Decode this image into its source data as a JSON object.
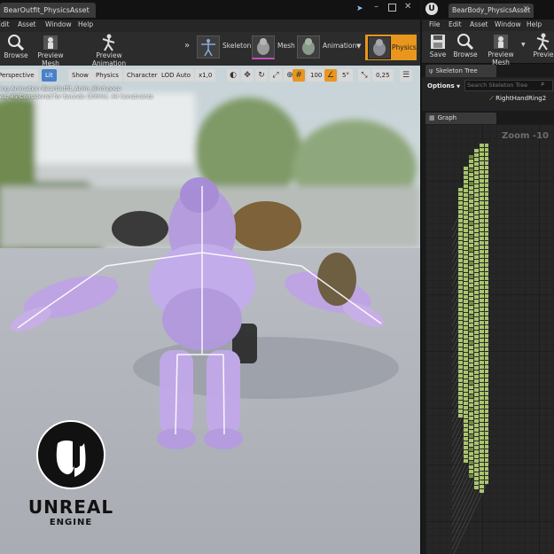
{
  "left_window": {
    "tab_title": "BearOutfit_PhysicsAsset",
    "menu": [
      "Edit",
      "Asset",
      "Window",
      "Help"
    ],
    "toolbar": [
      {
        "label": "Browse",
        "icon": "browse-icon"
      },
      {
        "label": "Preview Mesh",
        "icon": "preview-mesh-icon"
      },
      {
        "label": "Preview Animation",
        "icon": "preview-animation-icon"
      }
    ],
    "modes": [
      {
        "label": "Skeleton",
        "icon": "skeleton-icon"
      },
      {
        "label": "Mesh",
        "icon": "mesh-icon"
      },
      {
        "label": "Animation",
        "icon": "animation-icon"
      },
      {
        "label": "Physics",
        "icon": "physics-icon",
        "active": true
      }
    ],
    "viewport_toolbar": {
      "perspective": "Perspective",
      "lit": "Lit",
      "show": "Show",
      "physics": "Physics",
      "character": "Character",
      "lod": "LOD Auto",
      "speed": "x1,0",
      "grid_size": "100",
      "angle": "5°",
      "scale": "0,25"
    },
    "viewport_info": [
      "ing Animation BearOutfit_Anim_Bind-pose",
      "es, 45 Considered for bounds (100%), 44 Constraints"
    ],
    "logo": {
      "line1": "UNREAL",
      "line2": "ENGINE"
    }
  },
  "right_window": {
    "tab_title": "BearBody_PhysicsAsset",
    "menu": [
      "File",
      "Edit",
      "Asset",
      "Window",
      "Help"
    ],
    "toolbar": [
      {
        "label": "Save",
        "icon": "save-icon"
      },
      {
        "label": "Browse",
        "icon": "browse-icon"
      },
      {
        "label": "Preview Mesh",
        "icon": "preview-mesh-icon"
      },
      {
        "label": "Previe",
        "icon": "preview-animation-icon"
      }
    ],
    "skeleton_tree": {
      "tab": "Skeleton Tree",
      "options": "Options",
      "search_placeholder": "Search Skeleton Tree",
      "selected_item": "RightHandRing2"
    },
    "graph": {
      "tab": "Graph",
      "zoom": "Zoom -10"
    }
  },
  "colors": {
    "accent": "#e8961e",
    "graph_node": "#a8c46a",
    "graph_node_dark": "#6f8a3a"
  }
}
